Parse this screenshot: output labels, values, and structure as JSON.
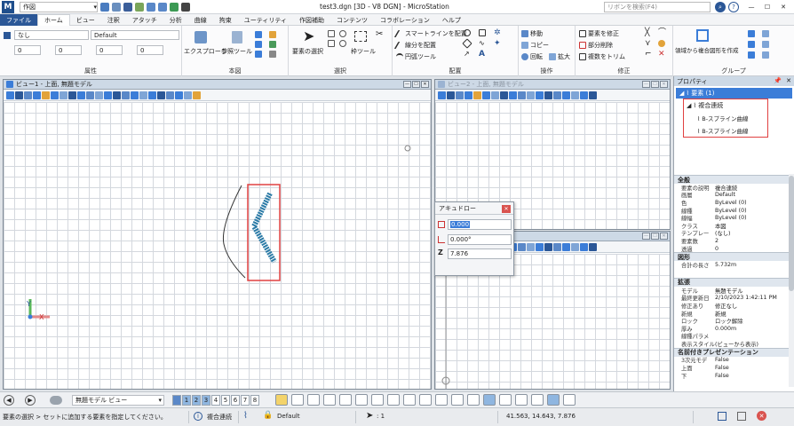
{
  "app": {
    "workset": "作図",
    "window_title": "test3.dgn [3D - V8 DGN] - MicroStation",
    "search_placeholder": "リボンを検索(F4)"
  },
  "ribbon_tabs": [
    "ファイル",
    "ホーム",
    "ビュー",
    "注釈",
    "アタッチ",
    "分析",
    "曲線",
    "拘束",
    "ユーティリティ",
    "作図補助",
    "コンテンツ",
    "コラボレーション",
    "ヘルプ"
  ],
  "ribbon": {
    "attributes": {
      "label": "属性",
      "level": "なし",
      "style": "Default",
      "color": "0",
      "weight": "0",
      "linestyle": "0",
      "transparency": "0"
    },
    "primary": {
      "label": "本図",
      "explorer": "エクスプローラ",
      "reference": "参照ツール"
    },
    "selection": {
      "label": "選択",
      "select_element": "要素の選択",
      "fence": "枠ツール"
    },
    "placement": {
      "label": "配置",
      "smartline": "スマートラインを配置",
      "polyline": "線分を配置",
      "arc": "円弧ツール"
    },
    "operations": {
      "label": "操作",
      "move": "移動",
      "copy": "コピー",
      "rotate": "回転",
      "scale": "拡大"
    },
    "modify": {
      "label": "修正",
      "modify_element": "要素を修正",
      "partial_delete": "部分削除",
      "trim_multiple": "複数をトリム"
    },
    "group": {
      "label": "グループ",
      "create_region": "領域から複合図形を作成"
    }
  },
  "views": {
    "view1_title": "ビュー1 - 上面, 無題モデル",
    "view2_title": "ビュー2 - 上面, 無題モデル"
  },
  "accudraw": {
    "title": "アキュドロー",
    "distance": "0.000",
    "angle": "0.000°",
    "z_label": "Z",
    "z": "7.876"
  },
  "properties": {
    "title": "プロパティ",
    "root": "要素 (1)",
    "tree_parent": "複合連続",
    "tree_children": [
      "B-スプライン曲線",
      "B-スプライン曲線"
    ],
    "sections": [
      {
        "name": "全般",
        "rows": [
          [
            "要素の説明",
            "複合連続"
          ],
          [
            "画層",
            "Default"
          ],
          [
            "色",
            "ByLevel (0)"
          ],
          [
            "線種",
            "ByLevel (0)"
          ],
          [
            "線幅",
            "ByLevel (0)"
          ],
          [
            "クラス",
            "本図"
          ],
          [
            "テンプレー",
            "(なし)"
          ],
          [
            "要素数",
            "2"
          ],
          [
            "透過",
            "0"
          ]
        ]
      },
      {
        "name": "図形",
        "rows": [
          [
            "合計の長さ",
            "5.732m"
          ]
        ]
      },
      {
        "name": "拡張",
        "rows": [
          [
            "モデル",
            "無題モデル"
          ],
          [
            "最終更新日",
            "2/10/2023 1:42:11 PM"
          ],
          [
            "修正あり",
            "修正なし"
          ],
          [
            "新規",
            "新規"
          ],
          [
            "ロック",
            "ロック解除"
          ],
          [
            "厚み",
            "0.000m"
          ],
          [
            "線種パラメ",
            ""
          ],
          [
            "表示スタイル",
            "(ビューから表示)"
          ]
        ]
      },
      {
        "name": "名前付きプレゼンテーション",
        "rows": [
          [
            "3次元モデ",
            "False"
          ],
          [
            "上面",
            "False"
          ],
          [
            "下",
            "False"
          ]
        ]
      }
    ]
  },
  "bottom": {
    "model": "無題モデル ビュー",
    "view_numbers": [
      "1",
      "2",
      "3",
      "4",
      "5",
      "6",
      "7",
      "8"
    ],
    "active_views": [
      "1",
      "2",
      "3"
    ]
  },
  "status": {
    "prompt": "要素の選択 > セットに追加する要素を指定してください。",
    "element_type": "複合連続",
    "level": "Default",
    "count": ": 1",
    "coordinates": "41.563, 14.643, 7.876"
  },
  "colors": {
    "accent": "#2b5797",
    "selection": "#e04040",
    "view_title": "#cdd9e6"
  }
}
